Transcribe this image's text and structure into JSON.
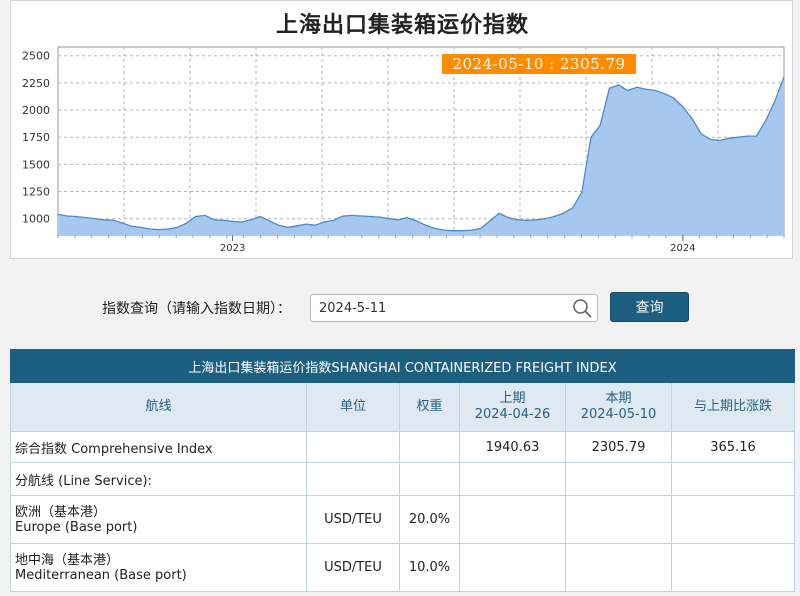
{
  "chart": {
    "title": "上海出口集装箱运价指数",
    "tooltip": "2024-05-10 : 2305.79"
  },
  "chart_data": {
    "type": "area",
    "title": "上海出口集装箱运价指数",
    "x_axis": {
      "labels": [
        "2023",
        "2024"
      ]
    },
    "y_axis": {
      "ticks": [
        1000,
        1250,
        1500,
        1750,
        2000,
        2250,
        2500
      ],
      "range": [
        850,
        2580
      ]
    },
    "grid": true,
    "series": [
      {
        "values": [
          1040,
          1025,
          1020,
          1010,
          1000,
          990,
          985,
          960,
          930,
          920,
          905,
          900,
          905,
          920,
          960,
          1020,
          1030,
          990,
          985,
          975,
          970,
          990,
          1020,
          980,
          940,
          920,
          935,
          950,
          940,
          970,
          985,
          1025,
          1030,
          1025,
          1020,
          1015,
          1000,
          990,
          1010,
          980,
          940,
          910,
          895,
          890,
          890,
          895,
          910,
          980,
          1050,
          1010,
          990,
          985,
          990,
          1000,
          1020,
          1050,
          1100,
          1240,
          1750,
          1860,
          2200,
          2230,
          2180,
          2210,
          2190,
          2180,
          2150,
          2110,
          2030,
          1920,
          1780,
          1730,
          1720,
          1740,
          1750,
          1760,
          1760,
          1900,
          2080,
          2305.79
        ]
      }
    ],
    "x_markers": {
      "2023": 19,
      "2024": 68
    }
  },
  "query": {
    "label": "指数查询（请输入指数日期）：",
    "input_value": "2024-5-11",
    "button_label": "查询"
  },
  "table": {
    "caption": "上海出口集装箱运价指数SHANGHAI CONTAINERIZED FREIGHT INDEX",
    "headers": {
      "route": "航线",
      "unit": "单位",
      "weight": "权重",
      "prev_label": "上期",
      "prev_date": "2024-04-26",
      "curr_label": "本期",
      "curr_date": "2024-05-10",
      "change": "与上期比涨跌"
    },
    "composite": {
      "name": "综合指数 Comprehensive Index",
      "prev": "1940.63",
      "curr": "2305.79",
      "change": "365.16"
    },
    "line_service": "分航线 (Line Service):",
    "rows": [
      {
        "name_cn": "欧洲（基本港）",
        "name_en": "Europe (Base port)",
        "unit": "USD/TEU",
        "weight": "20.0%"
      },
      {
        "name_cn": "地中海（基本港）",
        "name_en": "Mediterranean (Base port)",
        "unit": "USD/TEU",
        "weight": "10.0%"
      }
    ]
  }
}
